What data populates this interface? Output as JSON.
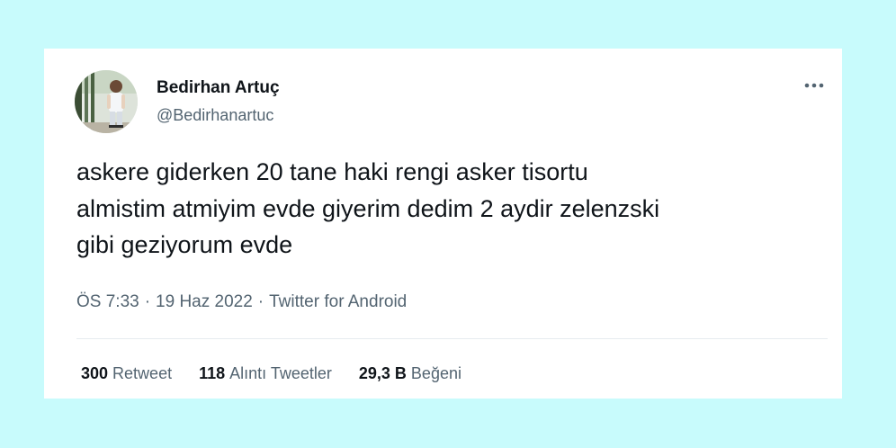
{
  "page": {
    "background": "#c8fbfc"
  },
  "tweet": {
    "author": {
      "display_name": "Bedirhan Artuç",
      "handle": "@Bedirhanartuc",
      "avatar_icon": "profile-photo"
    },
    "more_icon": "more-horizontal-icon",
    "text": "askere giderken 20 tane haki rengi asker tisortu\nalmistim atmiyim evde giyerim dedim 2 aydir zelenzski\ngibi geziyorum evde",
    "time": "ÖS 7:33",
    "date": "19 Haz 2022",
    "source": "Twitter for Android",
    "separator": "·",
    "stats": {
      "retweets": {
        "count": "300",
        "label": "Retweet"
      },
      "quotes": {
        "count": "118",
        "label": "Alıntı Tweetler"
      },
      "likes": {
        "count": "29,3 B",
        "label": "Beğeni"
      }
    }
  },
  "colors": {
    "text_primary": "#0f1419",
    "text_secondary": "#536471",
    "divider": "#e6ecf0"
  }
}
